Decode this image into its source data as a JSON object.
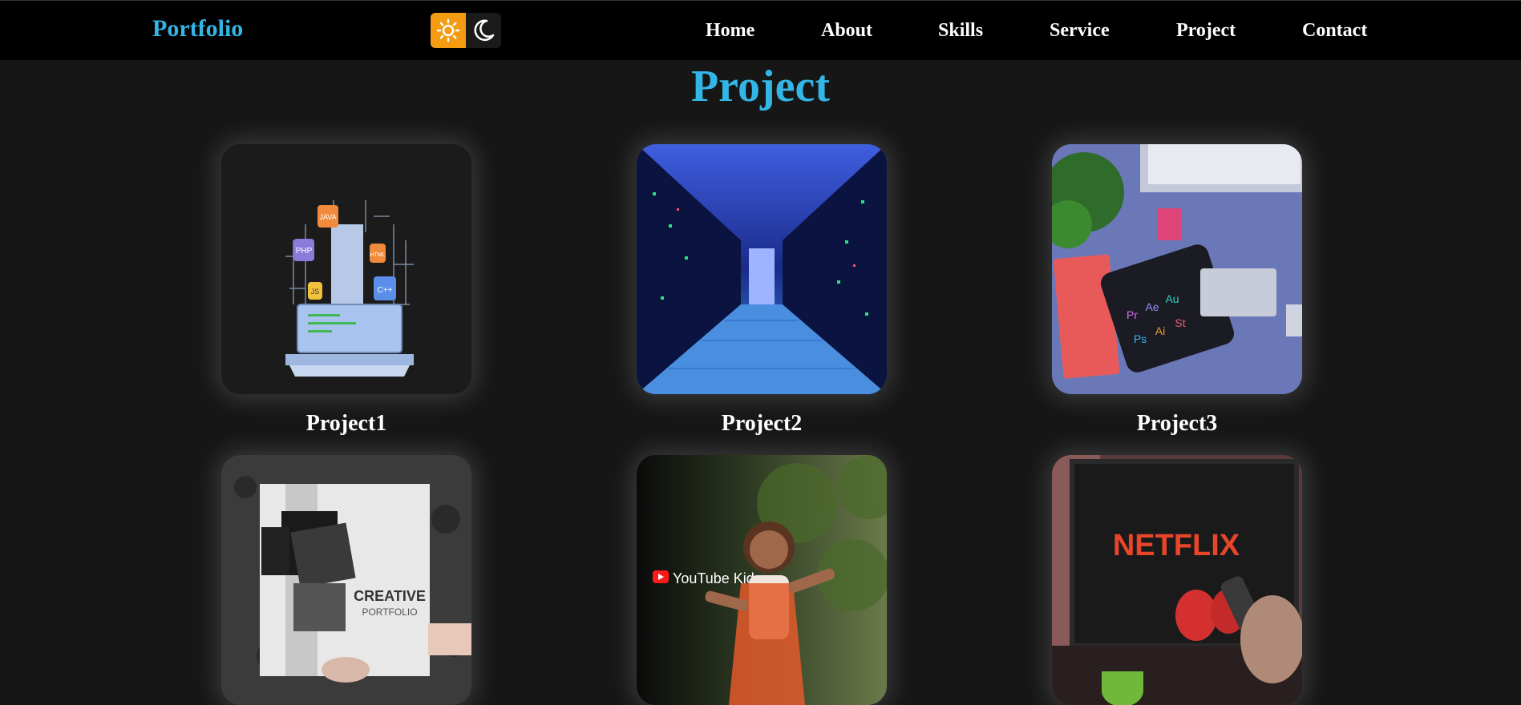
{
  "nav": {
    "logo": "Portfolio",
    "items": [
      "Home",
      "About",
      "Skills",
      "Service",
      "Project",
      "Contact"
    ]
  },
  "theme": {
    "light_icon": "sun-icon",
    "dark_icon": "moon-icon",
    "light_color": "#f39c12"
  },
  "section": {
    "title": "Project"
  },
  "projects": [
    {
      "label": "Project1",
      "image_texts": [
        "JAVA",
        "PHP",
        "HTML",
        "JS",
        "C++"
      ]
    },
    {
      "label": "Project2"
    },
    {
      "label": "Project3",
      "image_texts": [
        "Pr",
        "Ae",
        "Au",
        "Ps",
        "Ai",
        "St"
      ]
    },
    {
      "label": "",
      "image_texts": [
        "CREATIVE",
        "PORTFOLIO"
      ]
    },
    {
      "label": "",
      "image_texts": [
        "YouTube Kids"
      ]
    },
    {
      "label": "",
      "image_texts": [
        "NETFLIX"
      ]
    }
  ],
  "colors": {
    "accent": "#33b5e5",
    "background": "#161616",
    "navbar": "#000000"
  }
}
